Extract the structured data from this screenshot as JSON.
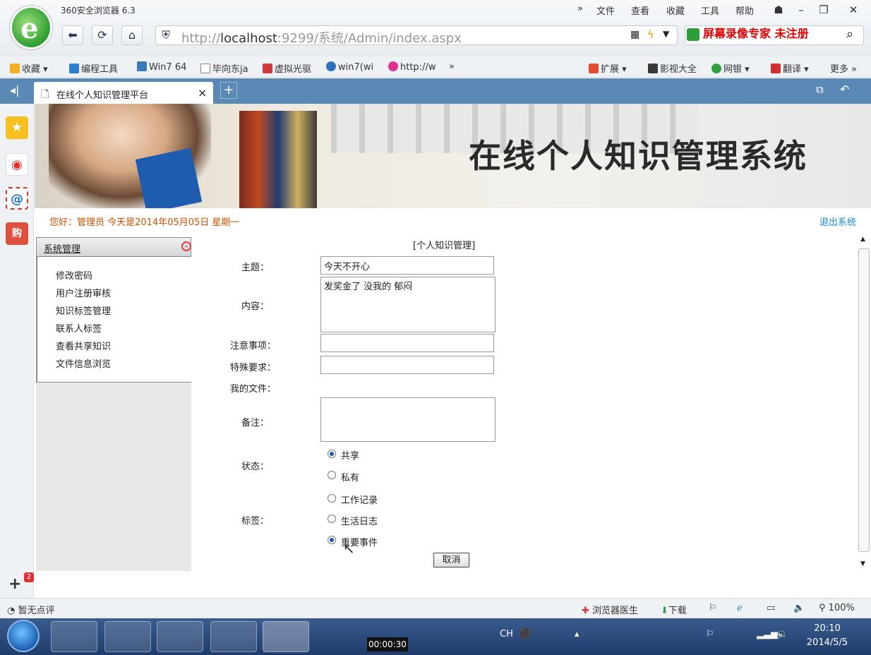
{
  "app": {
    "title": "360安全浏览器 6.3"
  },
  "menu": {
    "file": "文件",
    "view": "查看",
    "fav": "收藏",
    "tools": "工具",
    "help": "帮助"
  },
  "address": {
    "prefix": "http://",
    "host": "localhost",
    "rest": ":9299/系统/Admin/index.aspx"
  },
  "recorder_watermark": "屏幕录像专家  未注册",
  "bookmarks": {
    "fav": "收藏",
    "items": [
      "编程工具",
      "Win7 64",
      "毕向东ja",
      "虚拟光驱",
      "win7(wi",
      "http://w"
    ],
    "more_arrow": "»",
    "ext": "扩展",
    "movies": "影视大全",
    "bank": "网银",
    "translate": "翻译",
    "more": "更多 »"
  },
  "tab": {
    "title": "在线个人知识管理平台",
    "close": "×",
    "new": "+"
  },
  "banner": {
    "title": "在线个人知识管理系统"
  },
  "greeting": "您好：管理员   今天是2014年05月05日   星期一",
  "logout": "退出系统",
  "sidemenu": {
    "header": "系统管理",
    "items": [
      "修改密码",
      "用户注册审核",
      "知识标签管理",
      "联系人标签",
      "查看共享知识",
      "文件信息浏览"
    ]
  },
  "form": {
    "heading": "[个人知识管理]",
    "subject_label": "主题：",
    "subject": "今天不开心",
    "content_label": "内容：",
    "content": "发奖金了 没我的 郁闷",
    "notes_label": "注意事项：",
    "notes": "",
    "special_label": "特殊要求：",
    "special": "",
    "file_label": "我的文件：",
    "remark_label": "备注：",
    "remark": "",
    "status_label": "状态：",
    "status_options": [
      "共享",
      "私有"
    ],
    "status_selected": "共享",
    "tag_label": "标签：",
    "tag_options": [
      "工作记录",
      "生活日志",
      "重要事件"
    ],
    "tag_selected": "重要事件",
    "cancel": "取消"
  },
  "statusbar": {
    "left": "暂无点评",
    "doctor": "浏览器医生",
    "download": "下载",
    "zoom": "100%"
  },
  "taskbar": {
    "rec_time": "00:00:30",
    "time": "20:10",
    "date": "2014/5/5",
    "lang": "CH"
  },
  "sidebar_badge": "2"
}
